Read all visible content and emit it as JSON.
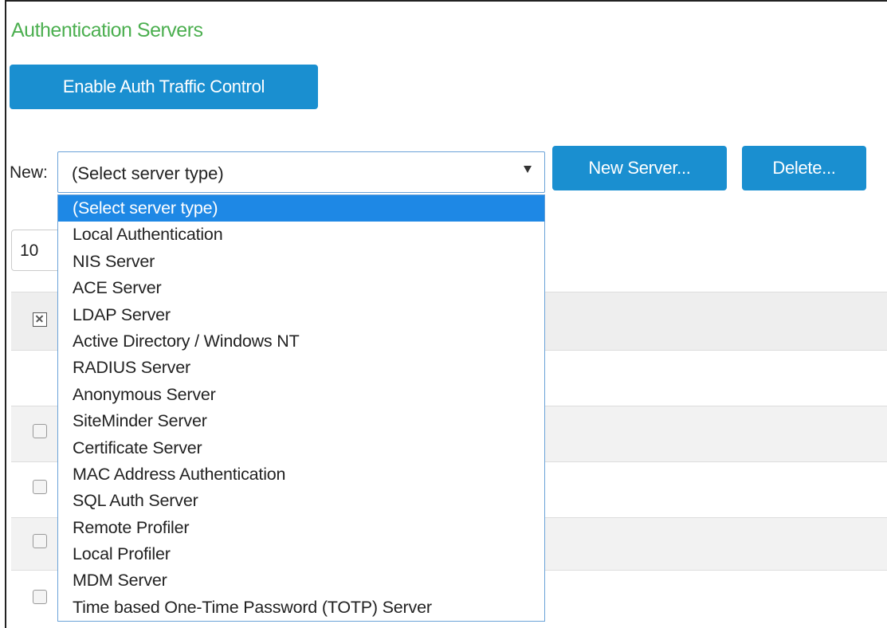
{
  "page": {
    "title": "Authentication Servers"
  },
  "toolbar": {
    "enable_auth_traffic_label": "Enable Auth Traffic Control",
    "new_label": "New:",
    "new_server_label": "New Server...",
    "delete_label": "Delete..."
  },
  "server_type_select": {
    "value": "(Select server type)",
    "options": [
      "(Select server type)",
      "Local Authentication",
      "NIS Server",
      "ACE Server",
      "LDAP Server",
      "Active Directory / Windows NT",
      "RADIUS Server",
      "Anonymous Server",
      "SiteMinder Server",
      "Certificate Server",
      "MAC Address Authentication",
      "SQL Auth Server",
      "Remote Profiler",
      "Local Profiler",
      "MDM Server",
      "Time based One-Time Password (TOTP) Server"
    ],
    "highlighted_index": 0
  },
  "pagination": {
    "per_page_value": "10"
  },
  "colors": {
    "title_green": "#4caf50",
    "button_blue": "#1a8fd0",
    "highlight_blue": "#1e88e5"
  }
}
